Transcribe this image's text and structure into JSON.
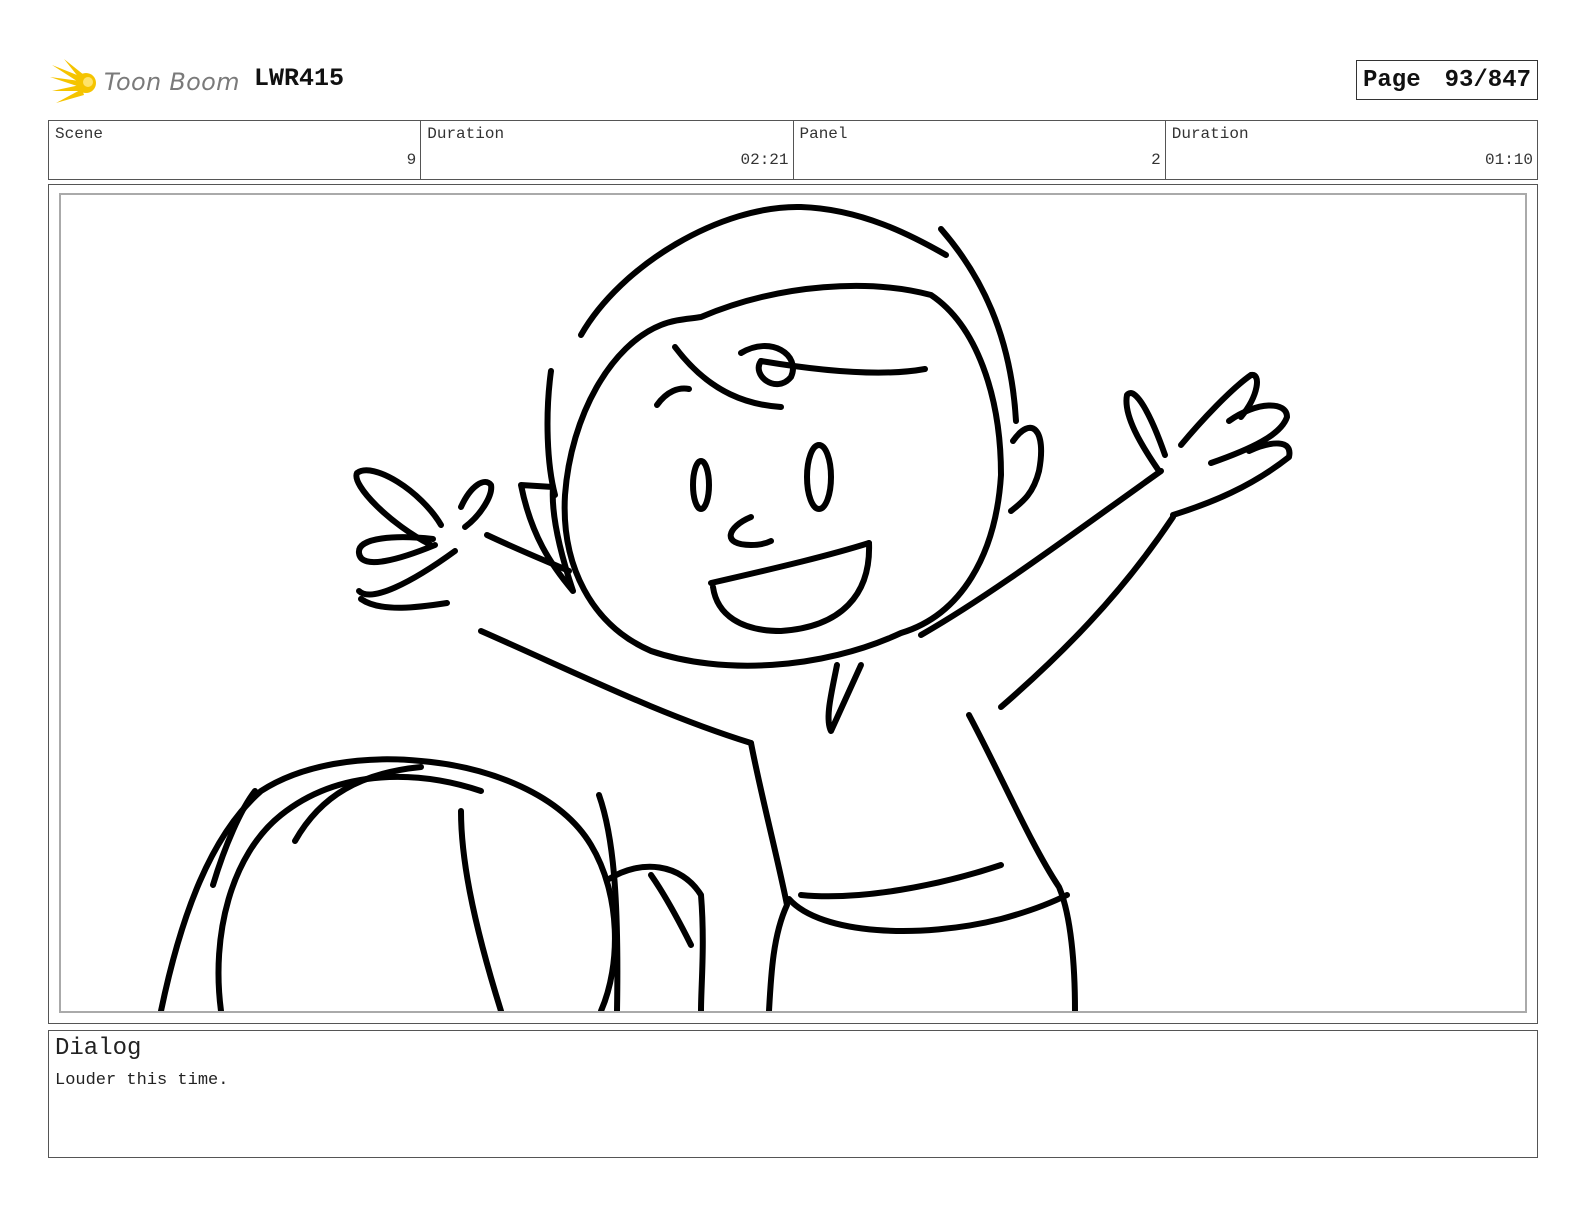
{
  "header": {
    "logo_text": "Toon Boom",
    "project_code": "LWR415",
    "page_label": "Page",
    "page_number": "93/847"
  },
  "info": {
    "scene_label": "Scene",
    "scene_value": "9",
    "scene_duration_label": "Duration",
    "scene_duration_value": "02:21",
    "panel_label": "Panel",
    "panel_value": "2",
    "panel_duration_label": "Duration",
    "panel_duration_value": "01:10"
  },
  "dialog": {
    "title": "Dialog",
    "text": "Louder this time."
  },
  "colors": {
    "logo_accent": "#f5c400",
    "logo_text": "#7a7a7a",
    "ink": "#000000"
  },
  "icons": {
    "logo": "toon-boom-star-icon"
  }
}
